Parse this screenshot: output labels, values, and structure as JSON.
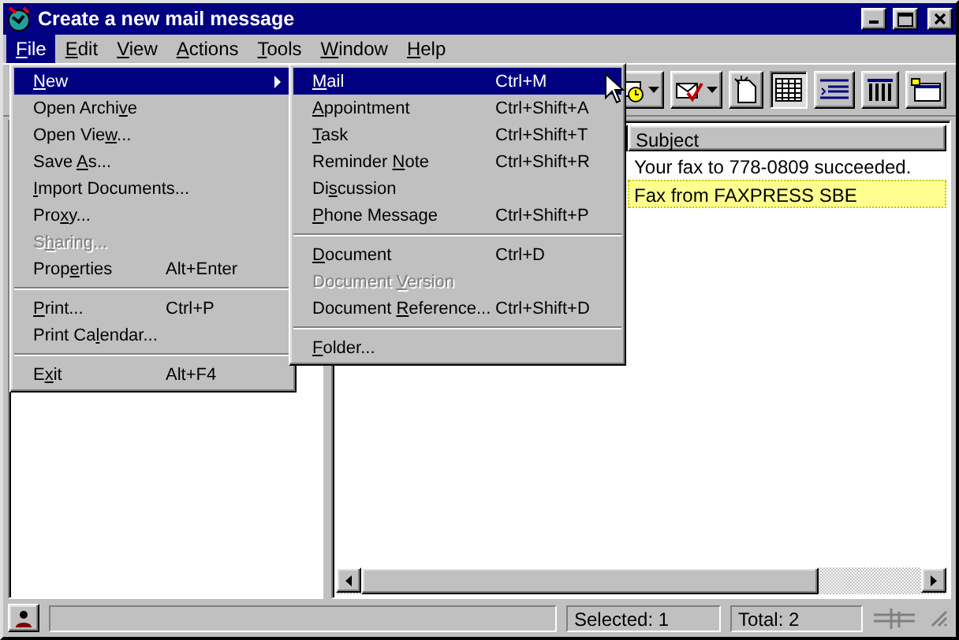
{
  "window": {
    "title": "Create a new mail message"
  },
  "menubar": [
    {
      "key": "F",
      "post": "ile",
      "selected": true
    },
    {
      "key": "E",
      "post": "dit",
      "selected": false
    },
    {
      "key": "V",
      "post": "iew",
      "selected": false
    },
    {
      "key": "A",
      "post": "ctions",
      "selected": false
    },
    {
      "key": "T",
      "post": "ools",
      "selected": false
    },
    {
      "key": "W",
      "post": "indow",
      "selected": false
    },
    {
      "key": "H",
      "post": "elp",
      "selected": false
    }
  ],
  "toolbar": [
    {
      "kind": "clock",
      "dropdown": true,
      "pressed": false
    },
    {
      "kind": "envelope-check",
      "dropdown": true,
      "pressed": false
    },
    {
      "kind": "new-doc",
      "dropdown": false,
      "pressed": false
    },
    {
      "kind": "table",
      "dropdown": false,
      "pressed": true
    },
    {
      "kind": "list",
      "dropdown": false,
      "pressed": false
    },
    {
      "kind": "columns",
      "dropdown": false,
      "pressed": false
    },
    {
      "kind": "window",
      "dropdown": false,
      "pressed": false
    }
  ],
  "table": {
    "columns": [
      "Subject"
    ],
    "rows": [
      {
        "subject": "Your fax to 778-0809 succeeded.",
        "selected": false
      },
      {
        "subject": "Fax from FAXPRESS SBE",
        "selected": true
      }
    ]
  },
  "file_menu": [
    {
      "kind": "item",
      "key": "N",
      "post": "ew",
      "submenu": true,
      "selected": true,
      "disabled": false
    },
    {
      "kind": "item",
      "pre": "Open Archi",
      "key": "v",
      "post": "e",
      "selected": false,
      "disabled": false
    },
    {
      "kind": "item",
      "pre": "Open Vie",
      "key": "w",
      "post": "...",
      "selected": false,
      "disabled": false
    },
    {
      "kind": "item",
      "pre": "Save ",
      "key": "A",
      "post": "s...",
      "selected": false,
      "disabled": false
    },
    {
      "kind": "item",
      "key": "I",
      "post": "mport Documents...",
      "selected": false,
      "disabled": false
    },
    {
      "kind": "item",
      "pre": "Pro",
      "key": "x",
      "post": "y...",
      "selected": false,
      "disabled": false
    },
    {
      "kind": "item",
      "pre": "S",
      "key": "h",
      "post": "aring...",
      "selected": false,
      "disabled": true
    },
    {
      "kind": "item",
      "pre": "Prop",
      "key": "e",
      "post": "rties",
      "shortcut": "Alt+Enter",
      "selected": false,
      "disabled": false
    },
    {
      "kind": "separator"
    },
    {
      "kind": "item",
      "key": "P",
      "post": "rint...",
      "shortcut": "Ctrl+P",
      "selected": false,
      "disabled": false
    },
    {
      "kind": "item",
      "pre": "Print Ca",
      "key": "l",
      "post": "endar...",
      "selected": false,
      "disabled": false
    },
    {
      "kind": "separator"
    },
    {
      "kind": "item",
      "pre": "E",
      "key": "x",
      "post": "it",
      "shortcut": "Alt+F4",
      "selected": false,
      "disabled": false
    }
  ],
  "new_submenu": [
    {
      "kind": "item",
      "key": "M",
      "post": "ail",
      "shortcut": "Ctrl+M",
      "selected": true,
      "disabled": false
    },
    {
      "kind": "item",
      "key": "A",
      "post": "ppointment",
      "shortcut": "Ctrl+Shift+A",
      "selected": false,
      "disabled": false
    },
    {
      "kind": "item",
      "key": "T",
      "post": "ask",
      "shortcut": "Ctrl+Shift+T",
      "selected": false,
      "disabled": false
    },
    {
      "kind": "item",
      "pre": "Reminder ",
      "key": "N",
      "post": "ote",
      "shortcut": "Ctrl+Shift+R",
      "selected": false,
      "disabled": false
    },
    {
      "kind": "item",
      "pre": "Di",
      "key": "s",
      "post": "cussion",
      "selected": false,
      "disabled": false
    },
    {
      "kind": "item",
      "key": "P",
      "post": "hone Message",
      "shortcut": "Ctrl+Shift+P",
      "selected": false,
      "disabled": false
    },
    {
      "kind": "separator"
    },
    {
      "kind": "item",
      "key": "D",
      "post": "ocument",
      "shortcut": "Ctrl+D",
      "selected": false,
      "disabled": false
    },
    {
      "kind": "item",
      "pre": "Document ",
      "key": "V",
      "post": "ersion",
      "selected": false,
      "disabled": true
    },
    {
      "kind": "item",
      "pre": "Document ",
      "key": "R",
      "post": "eference...",
      "shortcut": "Ctrl+Shift+D",
      "selected": false,
      "disabled": false
    },
    {
      "kind": "separator"
    },
    {
      "kind": "item",
      "key": "F",
      "post": "older...",
      "selected": false,
      "disabled": false
    }
  ],
  "status_bar": {
    "selected": "Selected: 1",
    "total": "Total: 2"
  }
}
